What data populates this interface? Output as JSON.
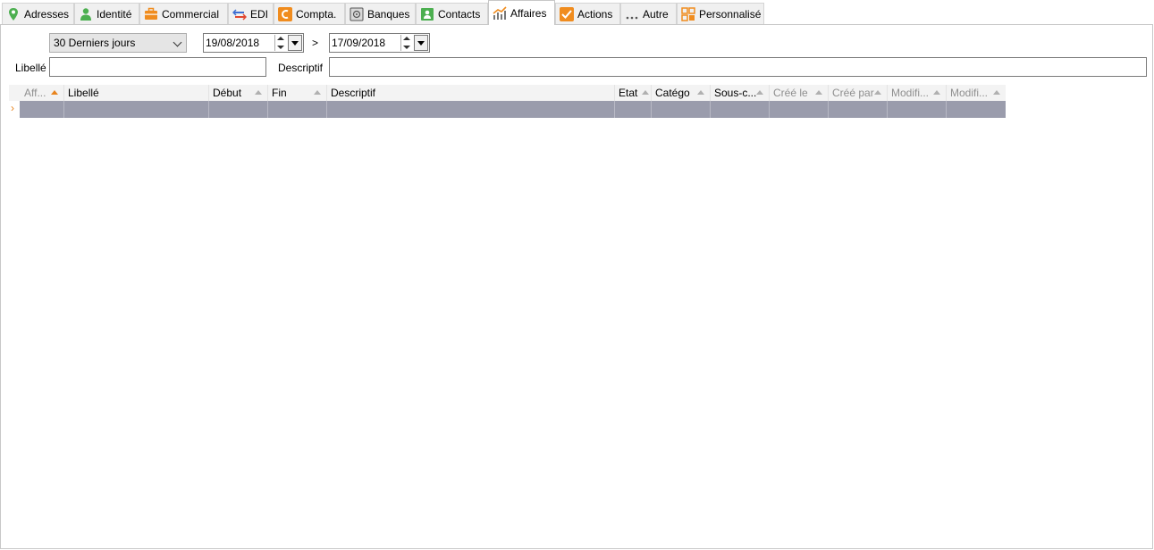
{
  "tabs": [
    {
      "label": "Adresses",
      "icon": "map-pin-icon"
    },
    {
      "label": "Identité",
      "icon": "person-icon"
    },
    {
      "label": "Commercial",
      "icon": "briefcase-icon"
    },
    {
      "label": "EDI",
      "icon": "exchange-arrows-icon"
    },
    {
      "label": "Compta.",
      "icon": "accounting-icon"
    },
    {
      "label": "Banques",
      "icon": "safe-icon"
    },
    {
      "label": "Contacts",
      "icon": "contact-card-icon"
    },
    {
      "label": "Affaires",
      "icon": "chart-trend-icon"
    },
    {
      "label": "Actions",
      "icon": "checkmark-icon"
    },
    {
      "label": "Autre",
      "icon": "ellipsis-icon"
    },
    {
      "label": "Personnalisé",
      "icon": "custom-grid-icon"
    }
  ],
  "active_tab": "Affaires",
  "filters": {
    "period": "30 Derniers jours",
    "date_from": "19/08/2018",
    "separator": ">",
    "date_to": "17/09/2018",
    "libelle_label": "Libellé",
    "libelle_value": "",
    "descriptif_label": "Descriptif",
    "descriptif_value": ""
  },
  "grid": {
    "columns": [
      "Aff...",
      "Libellé",
      "Début",
      "Fin",
      "Descriptif",
      "Etat",
      "Catégo",
      "Sous-c...",
      "Créé le",
      "Créé par",
      "Modifi...",
      "Modifi..."
    ],
    "row_indicator": "›"
  },
  "colors": {
    "accent": "#e8841e",
    "row_selected": "#9a9cac",
    "header_bg": "#f3f3f3"
  }
}
